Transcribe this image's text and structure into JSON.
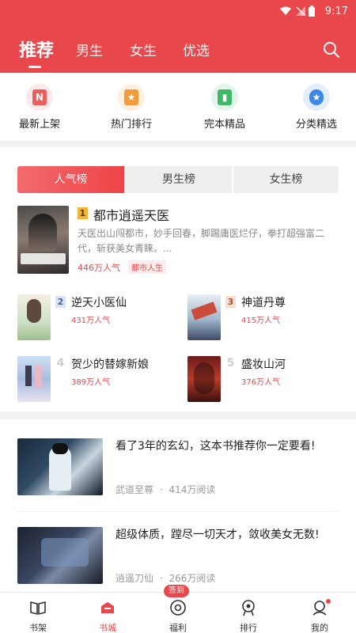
{
  "status_bar": {
    "time": "9:17"
  },
  "header": {
    "tabs": [
      {
        "label": "推荐",
        "active": true
      },
      {
        "label": "男生"
      },
      {
        "label": "女生"
      },
      {
        "label": "优选"
      }
    ]
  },
  "quick_nav": [
    {
      "label": "最新上架",
      "icon": "new-shelf-icon",
      "icon_text": "N",
      "color": "#ef5c5c",
      "bg": "#fde9e9"
    },
    {
      "label": "热门排行",
      "icon": "hot-rank-icon",
      "icon_text": "★",
      "color": "#f39b3a",
      "bg": "#fdf0df"
    },
    {
      "label": "完本精品",
      "icon": "completed-book-icon",
      "icon_text": "▮",
      "color": "#3fb868",
      "bg": "#e3f5ea"
    },
    {
      "label": "分类精选",
      "icon": "category-icon",
      "icon_text": "★",
      "color": "#3e86e8",
      "bg": "#e3eefc"
    }
  ],
  "ranking": {
    "tabs": [
      {
        "label": "人气榜",
        "active": true
      },
      {
        "label": "男生榜"
      },
      {
        "label": "女生榜"
      }
    ],
    "top_book": {
      "rank": "1",
      "title": "都市逍遥天医",
      "desc": "天医出山闯都市，妙手回春，脚踢庸医烂仔，拳打超强富二代，斩获美女青睐。...",
      "popularity": "446万人气",
      "tag": "都市人生"
    },
    "books": [
      {
        "rank": "2",
        "title": "逆天小医仙",
        "popularity": "431万人气"
      },
      {
        "rank": "3",
        "title": "神道丹尊",
        "popularity": "415万人气"
      },
      {
        "rank": "4",
        "title": "贺少的替嫁新娘",
        "popularity": "389万人气"
      },
      {
        "rank": "5",
        "title": "盛妆山河",
        "popularity": "376万人气"
      }
    ]
  },
  "articles": [
    {
      "title": "看了3年的玄幻，这本书推荐你一定要看!",
      "author": "武道至尊",
      "reads": "414万阅读"
    },
    {
      "title": "超级体质，蹚尽一切天才，敛收美女无数!",
      "author": "逍遥刀仙",
      "reads": "266万阅读"
    }
  ],
  "bottom_nav": [
    {
      "label": "书架",
      "icon": "bookshelf-icon"
    },
    {
      "label": "书城",
      "icon": "bookstore-icon",
      "active": true
    },
    {
      "label": "福利",
      "icon": "welfare-icon",
      "badge": "签到"
    },
    {
      "label": "排行",
      "icon": "ranking-icon"
    },
    {
      "label": "我的",
      "icon": "profile-icon",
      "dot": true
    }
  ],
  "colors": {
    "brand": "#e8484c",
    "accent_text": "#e8484c",
    "gold_badge": "#f2b535"
  }
}
